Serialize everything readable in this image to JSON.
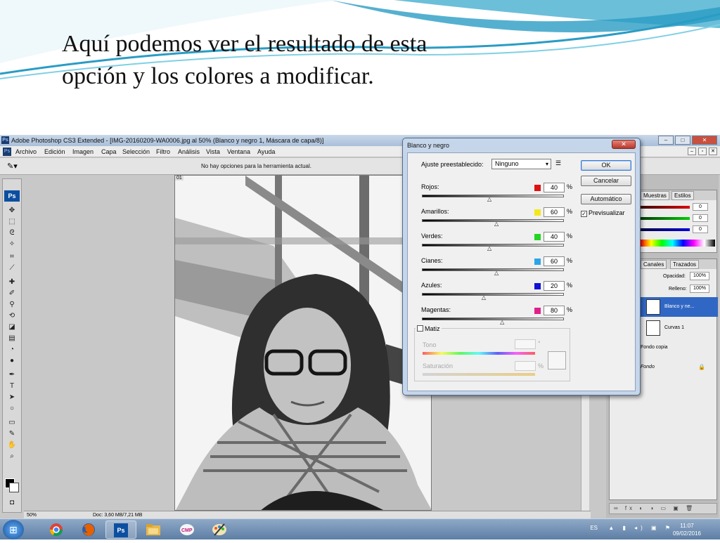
{
  "slide": {
    "title_line1": "Aquí podemos ver el resultado de esta",
    "title_line2": "opción y los colores a modificar."
  },
  "photoshop": {
    "window_title": "Adobe Photoshop CS3 Extended - [IMG-20160209-WA0006.jpg al 50% (Blanco y negro 1, Máscara de capa/8)]",
    "app_badge": "Ps",
    "menu": [
      "Archivo",
      "Edición",
      "Imagen",
      "Capa",
      "Selección",
      "Filtro",
      "Análisis",
      "Vista",
      "Ventana",
      "Ayuda"
    ],
    "options_text": "No hay opciones para la herramienta actual.",
    "doc_tab": "01",
    "status": {
      "zoom": "50%",
      "doc_size": "Doc: 3,60 MB/7,21 MB"
    }
  },
  "dialog": {
    "title": "Blanco y negro",
    "preset_label": "Ajuste preestablecido:",
    "preset_value": "Ninguno",
    "buttons": {
      "ok": "OK",
      "cancel": "Cancelar",
      "auto": "Automático"
    },
    "preview_label": "Previsualizar",
    "preview_checked": true,
    "channels": [
      {
        "name": "Rojos:",
        "value": "40",
        "color": "#e01010",
        "slider_pos": 0.48
      },
      {
        "name": "Amarillos:",
        "value": "60",
        "color": "#f4e81c",
        "slider_pos": 0.53
      },
      {
        "name": "Verdes:",
        "value": "40",
        "color": "#22d522",
        "slider_pos": 0.48
      },
      {
        "name": "Cianes:",
        "value": "60",
        "color": "#2aa6e6",
        "slider_pos": 0.53
      },
      {
        "name": "Azules:",
        "value": "20",
        "color": "#1010d8",
        "slider_pos": 0.44
      },
      {
        "name": "Magentas:",
        "value": "80",
        "color": "#e0208a",
        "slider_pos": 0.57
      }
    ],
    "percent": "%",
    "tint": {
      "label": "Matiz",
      "checked": false,
      "hue_label": "Tono",
      "hue_unit": "°",
      "sat_label": "Saturación",
      "sat_unit": "%"
    }
  },
  "panels": {
    "color_tabs": [
      "Muestras",
      "Estilos"
    ],
    "color_values": [
      "0",
      "0",
      "0"
    ],
    "layer_tabs": [
      "Canales",
      "Trazados"
    ],
    "opacity_label": "Opacidad:",
    "opacity_value": "100%",
    "fill_label": "Relleno:",
    "fill_value": "100%",
    "layers": [
      {
        "name": "Blanco y ne...",
        "selected": true
      },
      {
        "name": "Curvas 1",
        "selected": false
      },
      {
        "name": "Fondo copia",
        "selected": false
      },
      {
        "name": "Fondo",
        "selected": false
      }
    ]
  },
  "taskbar": {
    "language": "ES",
    "time": "11:07",
    "date": "09/02/2016"
  }
}
